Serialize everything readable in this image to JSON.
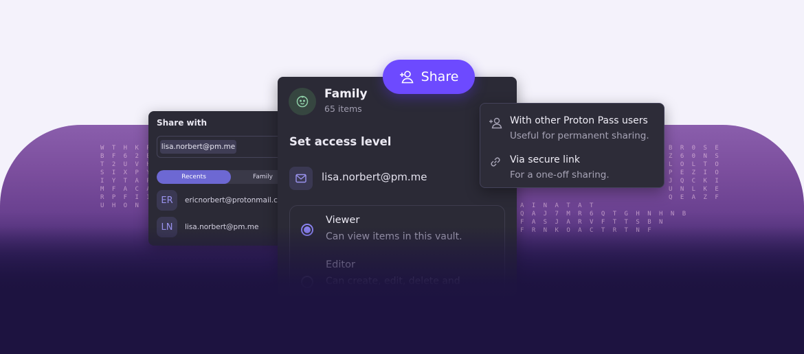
{
  "share_button": {
    "label": "Share",
    "icon": "add-user-icon"
  },
  "share_with_card": {
    "title": "Share with",
    "selected_chip": "lisa.norbert@pm.me",
    "tabs": [
      "Recents",
      "Family"
    ],
    "contacts": [
      {
        "initials": "ER",
        "email": "ericnorbert@protonmail.com"
      },
      {
        "initials": "LN",
        "email": "lisa.norbert@pm.me"
      }
    ]
  },
  "vault": {
    "name": "Family",
    "count": "65 items",
    "icon": "baby-face-icon"
  },
  "access": {
    "title": "Set access level",
    "recipient": "lisa.norbert@pm.me",
    "options": [
      {
        "title": "Viewer",
        "desc": "Can view items in this vault.",
        "selected": true
      },
      {
        "title": "Editor",
        "desc": "Can create, edit, delete and",
        "selected": false
      }
    ]
  },
  "share_menu": [
    {
      "label": "With other Proton Pass users",
      "sub": "Useful for permanent sharing.",
      "icon": "add-user-icon"
    },
    {
      "label": "Via secure link",
      "sub": "For a one-off sharing.",
      "icon": "link-icon"
    }
  ],
  "colors": {
    "accent": "#6d4aff",
    "card": "#2b2a36",
    "background_dark": "#1d1340",
    "purple": "#8a5eac"
  },
  "matrix_left": [
    "W T H K R",
    "B F 6 2 B",
    "T 2 U V H Z",
    "S I X P Y L",
    "I Y T A P",
    "M F A C A",
    "R P F I I",
    "U H O N"
  ],
  "matrix_right": [
    "B R 0 S E",
    "Z 6 0 N S",
    "L O L T O",
    "P E Z I O",
    "J Q C K I",
    "U N L K E",
    "Q E A Z F",
    "A I N A T A T",
    "Q A J 7 M R 6 Q T G H N H N B",
    "F A S J A R V F T T S B N",
    "F R N K O A C T R T N F"
  ]
}
